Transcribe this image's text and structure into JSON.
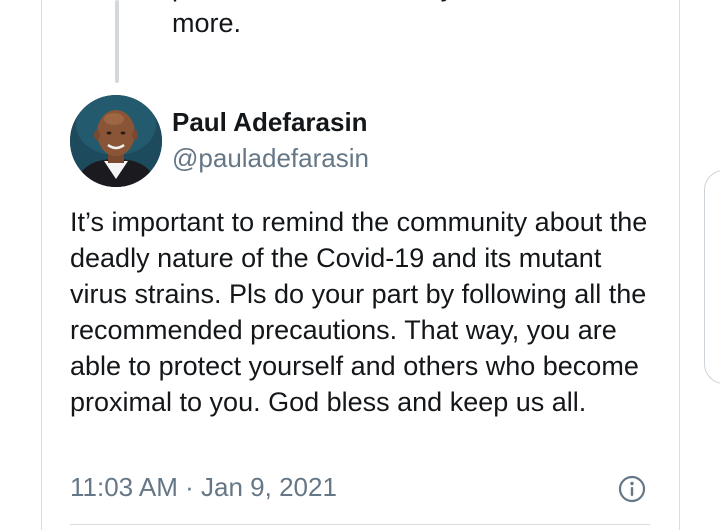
{
  "quoted_tweet": {
    "text": "pain of his loss but they will feel it a lot more."
  },
  "tweet": {
    "author": {
      "display_name": "Paul Adefarasin",
      "handle": "@pauladefarasin"
    },
    "text": "It’s important to remind the community about the deadly nature of the Covid-19 and its mutant virus strains. Pls do your part by following all the recommended precautions. That way, you are able to protect yourself and others who become proximal to you. God bless and keep us all.",
    "timestamp": "11:03 AM · Jan 9, 2021"
  },
  "icons": {
    "info": "info-icon",
    "avatar": "profile-photo"
  },
  "colors": {
    "text_primary": "#14171a",
    "text_secondary": "#657786",
    "border": "#d6dde3"
  }
}
